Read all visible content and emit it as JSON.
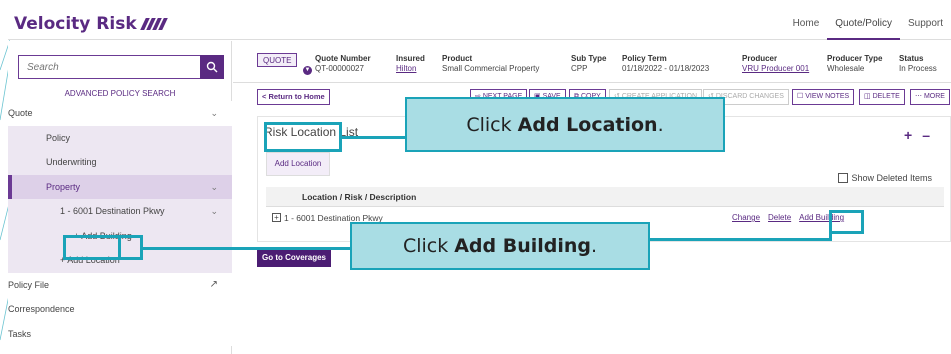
{
  "app": {
    "logo_text": "Velocity Risk",
    "nav": [
      "Home",
      "Quote/Policy",
      "Support"
    ]
  },
  "sidebar": {
    "search_placeholder": "Search",
    "advanced_search": "ADVANCED POLICY SEARCH",
    "items": [
      {
        "label": "Quote"
      },
      {
        "label": "Policy"
      },
      {
        "label": "Underwriting"
      },
      {
        "label": "Property"
      },
      {
        "label": "1 - 6001 Destination Pkwy"
      },
      {
        "label": "+ Add Building"
      },
      {
        "label": "+ Add Location"
      },
      {
        "label": "Policy File"
      },
      {
        "label": "Correspondence"
      },
      {
        "label": "Tasks"
      }
    ]
  },
  "quote": {
    "tag": "QUOTE",
    "fields": [
      {
        "label": "Quote Number",
        "value": "QT-00000027"
      },
      {
        "label": "Insured",
        "value": "Hilton"
      },
      {
        "label": "Product",
        "value": "Small Commercial Property"
      },
      {
        "label": "Sub Type",
        "value": "CPP"
      },
      {
        "label": "Policy Term",
        "value": "01/18/2022 - 01/18/2023"
      },
      {
        "label": "Producer",
        "value": "VRU Producer 001"
      },
      {
        "label": "Producer Type",
        "value": "Wholesale"
      },
      {
        "label": "Status",
        "value": "In Process"
      }
    ]
  },
  "toolbar": {
    "return_home": "< Return to Home",
    "next_page": "NEXT PAGE",
    "save": "SAVE",
    "copy": "COPY",
    "create_application": "CREATE APPLICATION",
    "discard_changes": "DISCARD CHANGES",
    "view_notes": "VIEW NOTES",
    "delete": "DELETE",
    "more": "MORE"
  },
  "risk": {
    "title": "Risk Location List",
    "add_location": "Add Location",
    "show_deleted": "Show Deleted Items",
    "column_header": "Location / Risk / Description",
    "row_text": "1 - 6001 Destination Pkwy",
    "actions": {
      "change": "Change",
      "delete": "Delete",
      "add_building": "Add Building"
    }
  },
  "go_to_coverages": "Go to Coverages",
  "callouts": {
    "c1_prefix": "Click",
    "c1_bold": "Add Location",
    "c1_suffix": ".",
    "c2_prefix": "Click",
    "c2_bold": "Add Building",
    "c2_suffix": "."
  },
  "colors": {
    "brand": "#5a2a82",
    "callout_border": "#1aa3b8",
    "callout_fill": "#a9dde4"
  }
}
